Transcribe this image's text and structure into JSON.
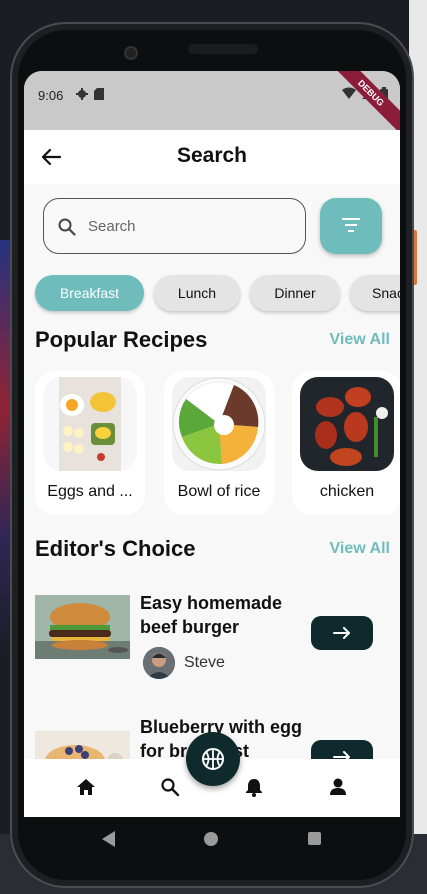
{
  "status": {
    "time": "9:06",
    "debug_label": "DEBUG"
  },
  "header": {
    "title": "Search"
  },
  "search": {
    "placeholder": "Search",
    "value": ""
  },
  "categories": [
    "Breakfast",
    "Lunch",
    "Dinner",
    "Snacks"
  ],
  "popular": {
    "title": "Popular Recipes",
    "view_all": "View All",
    "items": [
      {
        "name": "Eggs and ..."
      },
      {
        "name": "Bowl of rice"
      },
      {
        "name": "chicken"
      }
    ]
  },
  "editors": {
    "title": "Editor's Choice",
    "view_all": "View All",
    "items": [
      {
        "title": "Easy homemade beef burger",
        "author": "Steve"
      },
      {
        "title": "Blueberry with egg for breakfast",
        "author": ""
      }
    ]
  },
  "colors": {
    "accent": "#6fbcbc",
    "dark": "#0f2a2c"
  }
}
